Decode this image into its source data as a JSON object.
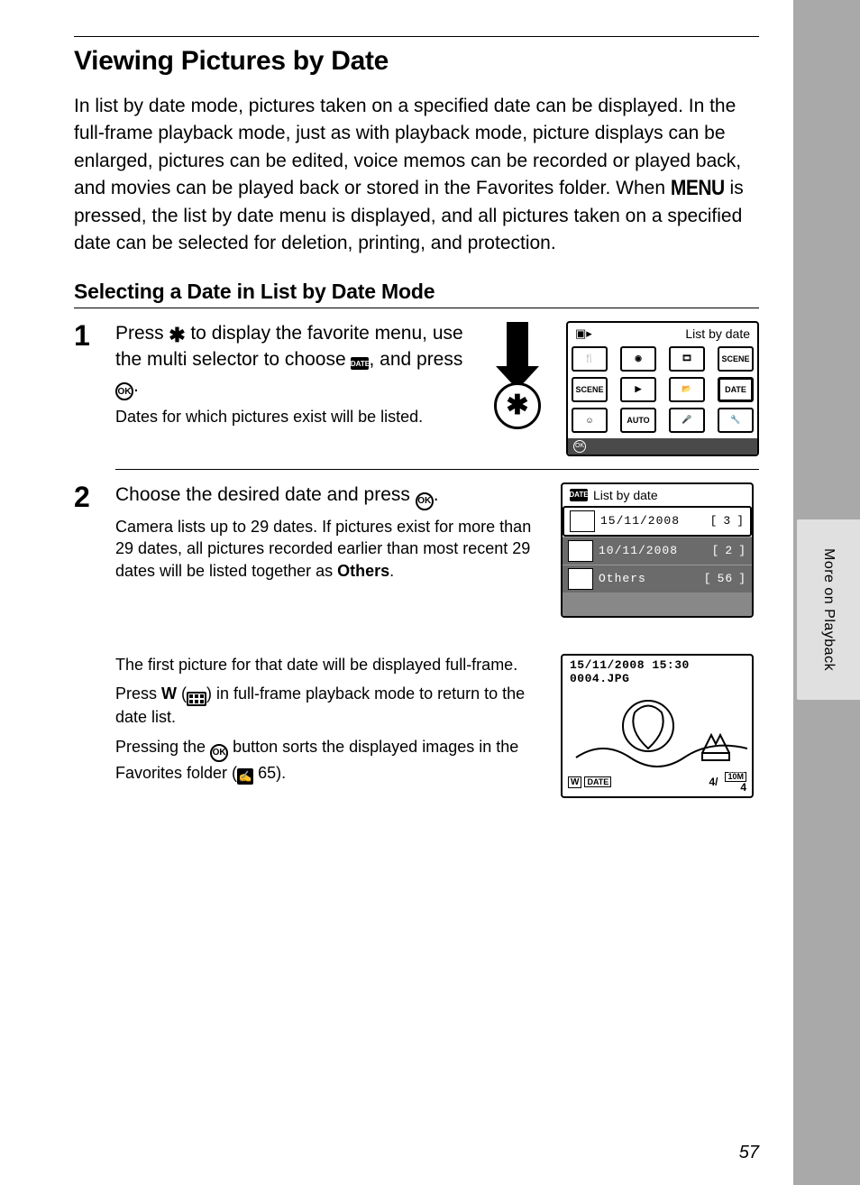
{
  "title": "Viewing Pictures by Date",
  "intro_a": "In list by date mode, pictures taken on a specified date can be displayed. In the full-frame playback mode, just as with playback mode, picture displays can be enlarged, pictures can be edited, voice memos can be recorded or played back, and movies can be played back or stored in the Favorites folder. When ",
  "intro_menu": "MENU",
  "intro_b": " is pressed, the list by date menu is displayed, and all pictures taken on a specified date can be selected for deletion, printing, and protection.",
  "subhead": "Selecting a Date in List by Date Mode",
  "step1": {
    "num": "1",
    "lead_a": "Press ",
    "lead_b": " to display the favorite menu, use the multi selector to choose ",
    "lead_c": ", and press ",
    "lead_d": ".",
    "sub": "Dates for which pictures exist will be listed.",
    "screen_title": "List by date",
    "icons": [
      "🍴",
      "📷",
      "🎞",
      "SCENE",
      "SCENE",
      "▶",
      "📂",
      "DATE",
      "😊",
      "AUTO",
      "🎤",
      "🔧"
    ],
    "ok": "OK"
  },
  "star_glyph": "✱",
  "date_glyph": "DATE",
  "ok_glyph": "OK",
  "step2": {
    "num": "2",
    "lead_a": "Choose the desired date and press ",
    "lead_b": ".",
    "sub_a": "Camera lists up to 29 dates. If pictures exist for more than 29 dates, all pictures recorded earlier than most recent 29 dates will be listed together as ",
    "sub_others": "Others",
    "sub_b": ".",
    "list_title": "List by date",
    "rows": [
      {
        "date": "15/11/2008",
        "count": "3",
        "sel": true
      },
      {
        "date": "10/11/2008",
        "count": "2",
        "sel": false
      },
      {
        "date": "Others",
        "count": "56",
        "sel": false
      }
    ],
    "p2": "The first picture for that date will be displayed full-frame.",
    "p3_a": "Press ",
    "p3_w": "W",
    "p3_b": " (",
    "p3_c": ") in full-frame playback mode to return to the date list.",
    "p4_a": "Pressing the ",
    "p4_b": " button sorts the displayed images in the Favorites folder (",
    "p4_ref": "65",
    "p4_c": ").",
    "photo": {
      "line1": "15/11/2008 15:30",
      "line2": "0004.JPG",
      "bl": "DATE",
      "counter": "4/",
      "br1": "10M",
      "br2": "4"
    }
  },
  "side_tab": "More on Playback",
  "page_num": "57",
  "ref_glyph": "✍"
}
